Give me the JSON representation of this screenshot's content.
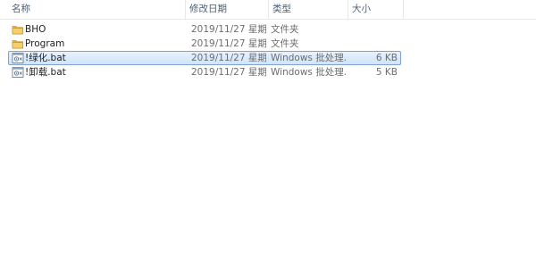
{
  "columns": {
    "name": "名称",
    "date": "修改日期",
    "type": "类型",
    "size": "大小"
  },
  "files": [
    {
      "name": "BHO",
      "date": "2019/11/27 星期...",
      "type": "文件夹",
      "size": "",
      "icon": "folder-icon",
      "selected": false
    },
    {
      "name": "Program",
      "date": "2019/11/27 星期...",
      "type": "文件夹",
      "size": "",
      "icon": "folder-icon",
      "selected": false
    },
    {
      "name": "!绿化.bat",
      "date": "2019/11/27 星期...",
      "type": "Windows 批处理...",
      "size": "6 KB",
      "icon": "batch-file-icon",
      "selected": true
    },
    {
      "name": "!卸载.bat",
      "date": "2019/11/27 星期...",
      "type": "Windows 批处理...",
      "size": "5 KB",
      "icon": "batch-file-icon",
      "selected": false
    }
  ],
  "colors": {
    "selection_border": "#7da2ce",
    "selection_fill": "#cfe4fb",
    "folder": "#e8b64a",
    "header_text": "#4c607a"
  }
}
